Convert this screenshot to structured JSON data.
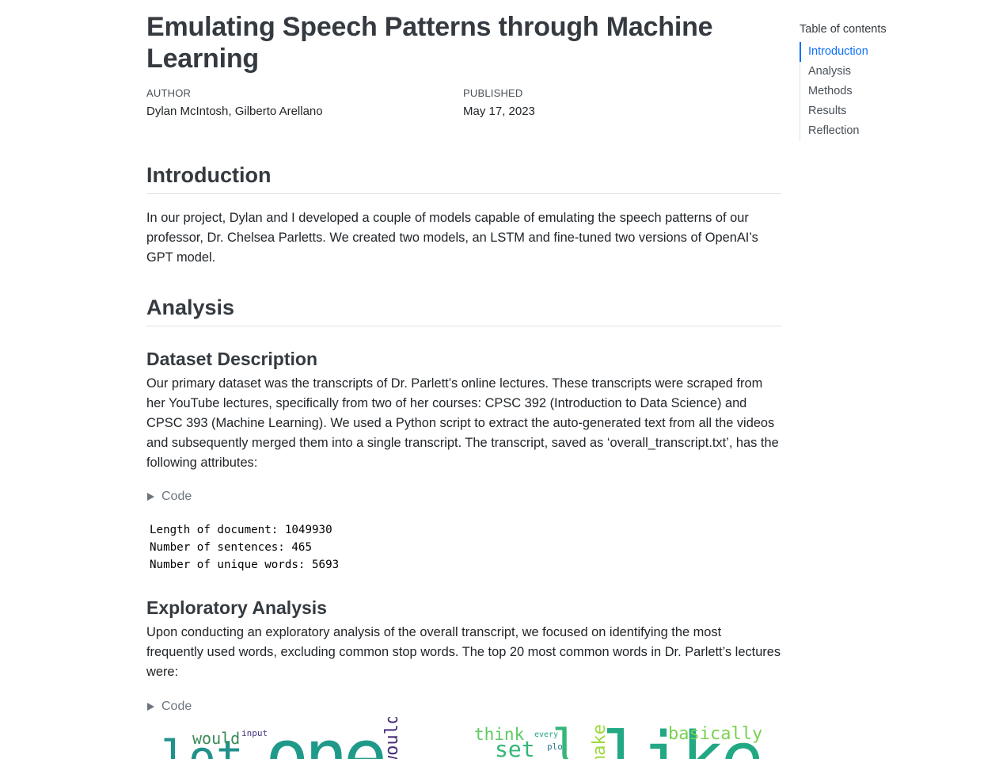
{
  "doc": {
    "title": "Emulating Speech Patterns through Machine Learning",
    "author_label": "AUTHOR",
    "authors": "Dylan McIntosh, Gilberto Arellano",
    "published_label": "PUBLISHED",
    "published_date": "May 17, 2023"
  },
  "intro": {
    "heading": "Introduction",
    "text": "In our project, Dylan and I developed a couple of models capable of emulating the speech patterns of our professor, Dr. Chelsea Parletts. We created two models, an LSTM and fine-tuned two versions of OpenAI’s GPT model."
  },
  "analysis": {
    "heading": "Analysis",
    "dataset": {
      "heading": "Dataset Description",
      "text": "Our primary dataset was the transcripts of Dr. Parlett’s online lectures. These transcripts were scraped from her YouTube lectures, specifically from two of her courses: CPSC 392 (Introduction to Data Science) and CPSC 393 (Machine Learning). We used a Python script to extract the auto-generated text from all the videos and subsequently merged them into a single transcript. The transcript, saved as ‘overall_transcript.txt’, has the following attributes:",
      "code_label": "Code",
      "output": [
        "Length of document: 1049930",
        "Number of sentences: 465",
        "Number of unique words: 5693"
      ]
    },
    "exploratory": {
      "heading": "Exploratory Analysis",
      "text": "Upon conducting an exploratory analysis of the overall transcript, we focused on identifying the most frequently used words, excluding common stop words. The top 20 most common words in Dr. Parlett’s lectures were:",
      "code_label": "Code"
    }
  },
  "wordcloud": {
    "words": [
      {
        "text": "lot",
        "color": "#21918c"
      },
      {
        "text": "would",
        "color": "#3b8a56"
      },
      {
        "text": "input",
        "color": "#46337e"
      },
      {
        "text": "one",
        "color": "#1f9a8a"
      },
      {
        "text": "would",
        "color": "#472c7a"
      },
      {
        "text": "think",
        "color": "#5ec962"
      },
      {
        "text": "set",
        "color": "#35b779"
      },
      {
        "text": "every",
        "color": "#20a486"
      },
      {
        "text": "plot",
        "color": "#2a788e"
      },
      {
        "text": "l",
        "color": "#35b779"
      },
      {
        "text": "make",
        "color": "#9dd93b"
      },
      {
        "text": "like",
        "color": "#22a884"
      },
      {
        "text": "basically",
        "color": "#7ad151"
      }
    ]
  },
  "toc": {
    "title": "Table of contents",
    "items": [
      "Introduction",
      "Analysis",
      "Methods",
      "Results",
      "Reflection"
    ]
  }
}
